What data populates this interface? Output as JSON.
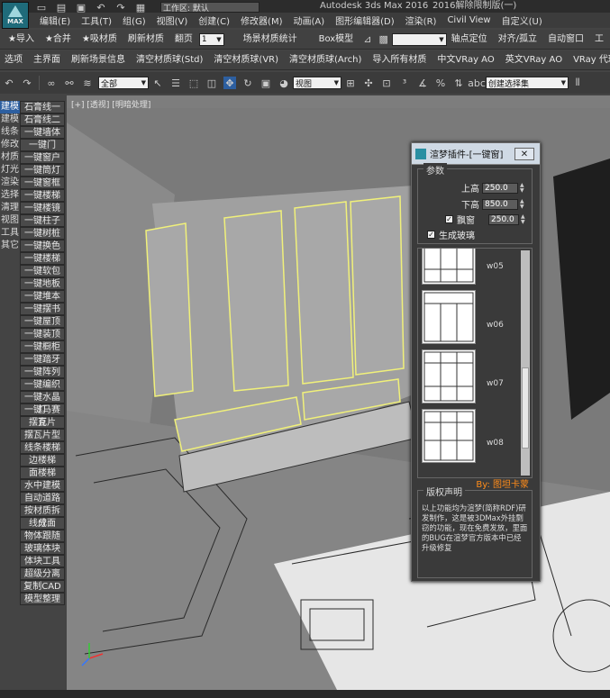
{
  "window": {
    "app_title": "Autodesk 3ds Max 2016",
    "edition": "2016解除限制版(一)",
    "workspace": "工作区: 默认",
    "logo": "MAX"
  },
  "menu": [
    "编辑(E)",
    "工具(T)",
    "组(G)",
    "视图(V)",
    "创建(C)",
    "修改器(M)",
    "动画(A)",
    "图形编辑器(D)",
    "渲染(R)",
    "Civil View",
    "自定义(U)"
  ],
  "toolbar1": {
    "import": "★导入",
    "merge": "★合并",
    "absorb": "★吸材质",
    "refresh": "刷新材质",
    "flip": "翻页",
    "page": "1",
    "scene_stats": "场景材质统计",
    "box_model": "Box模型",
    "axis": "轴点定位",
    "align": "对齐/孤立",
    "auto_window": "自动窗口",
    "tools": "工"
  },
  "toolbar2": [
    "选项",
    "主界面",
    "刷新场景信息",
    "清空材质球(Std)",
    "清空材质球(VR)",
    "清空材质球(Arch)",
    "导入所有材质",
    "中文VRay AO",
    "英文VRay AO",
    "VRay 代理",
    "重命名"
  ],
  "toolbar3": {
    "filter": "全部",
    "view": "视图",
    "named_sel": "创建选择集"
  },
  "left_tabs": [
    "建模",
    "建模",
    "线条",
    "修改",
    "材质",
    "灯光",
    "渲染",
    "选择",
    "清理",
    "视图",
    "工具",
    "其它"
  ],
  "left_buttons": [
    "石膏线一",
    "石膏线二",
    "一键墙体",
    "一键门",
    "一键窗户",
    "一键筒灯",
    "一键窗框",
    "一键楼梯",
    "一键楼镜",
    "一键柱子",
    "一键树桩",
    "一键换色",
    "一键楼梯",
    "一键软包",
    "一键地板",
    "一键堆本",
    "一键摆书",
    "一键屋顶",
    "一键装顶",
    "一键橱柜",
    "一键踏牙",
    "一键阵列",
    "一键编织",
    "一键水晶灯",
    "一键马赛克",
    "摆瓦片",
    "摆瓦片型",
    "线条楼梯",
    "边楼梯",
    "面楼梯",
    "水中建模",
    "自动道路",
    "按材质拆分",
    "线成面",
    "物体跟随",
    "玻璃体块",
    "体块工具",
    "超级分离",
    "复制CAD",
    "模型整理"
  ],
  "viewport": {
    "label": "[+] [透视] [明暗处理]"
  },
  "plugin": {
    "title": "渲梦插件-[一键窗]",
    "close": "✕",
    "params_label": "参数",
    "top_height_label": "上高",
    "top_height": "250.0",
    "bottom_height_label": "下高",
    "bottom_height": "850.0",
    "bay_label": "飘窗",
    "bay_value": "250.0",
    "glass_label": "生成玻璃",
    "thumbs": [
      "w05",
      "w06",
      "w07",
      "w08"
    ],
    "byline": "By: 图坦卡蒙",
    "notice_title": "版权声明",
    "notice_text": "以上功能均为渲梦(简称RDF)研发制作，这是被3DMax外挂剽窃的功能，现在免费发放，里面的BUG在渲梦官方版本中已经升级修复"
  },
  "colors": {
    "accent": "#2d5fa0",
    "byline": "#ff8c1a",
    "selection": "#f0f07a"
  }
}
